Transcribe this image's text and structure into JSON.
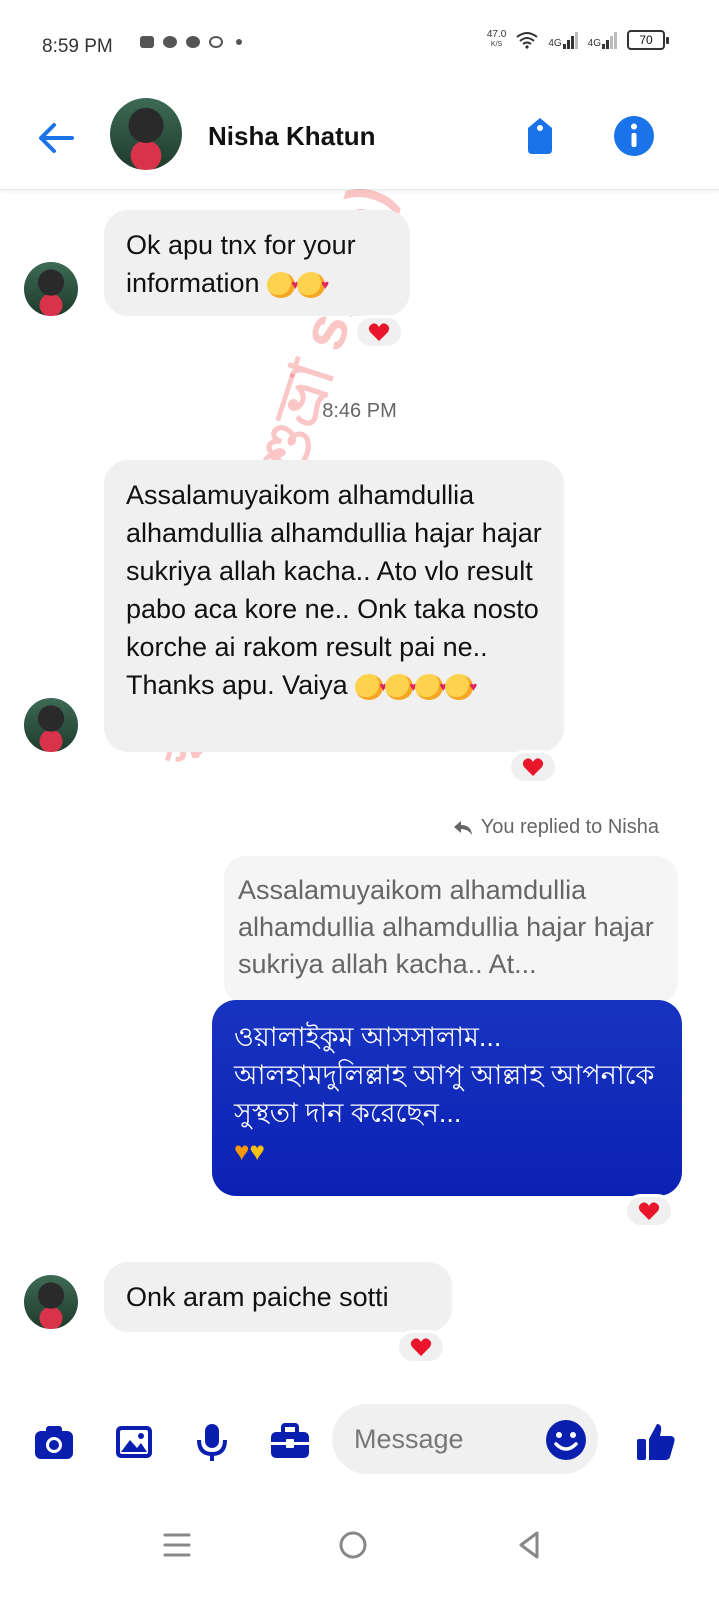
{
  "status_bar": {
    "time": "8:59 PM",
    "net_speed": "47.0",
    "net_unit": "K/S",
    "network_1": "4G",
    "network_2": "4G",
    "battery": "70"
  },
  "header": {
    "contact_name": "Nisha Khatun",
    "back_icon": "arrow-left-icon",
    "call_icon": "phone-tag-icon",
    "info_icon": "info-icon",
    "accent_color": "#1a73e8"
  },
  "messages": [
    {
      "sender": "Nisha",
      "text": "Ok apu tnx for your information",
      "emoji": "🥰🥰",
      "reaction": "❤️"
    },
    {
      "sender": "Nisha",
      "text": "Assalamuyaikom alhamdullia alhamdullia alhamdullia hajar hajar sukriya allah kacha.. Ato vlo result pabo aca kore ne.. Onk taka nosto korche ai rakom result pai ne.. Thanks apu. Vaiya",
      "emoji": "🥰🥰🥰🥰",
      "reaction": "❤️"
    },
    {
      "sender": "me",
      "reply_note": "You replied to Nisha",
      "quoted": "Assalamuyaikom alhamdullia alhamdullia alhamdullia hajar hajar sukriya allah kacha.. At...",
      "text": "ওয়ালাইকুম আসসালাম... আলহামদুলিল্লাহ আপু আল্লাহ আপনাকে সুস্থতা দান করেছেন...",
      "emoji": "🧡💛",
      "reaction": "❤️"
    },
    {
      "sender": "Nisha",
      "text": "Onk aram paiche sotti",
      "reaction": "❤️"
    }
  ],
  "timestamp": "8:46 PM",
  "watermark": "স্বপ্নের দেশ ( শুভ্রা shop)",
  "composer": {
    "placeholder": "Message",
    "bubble_out_color": "#0f28b8"
  }
}
